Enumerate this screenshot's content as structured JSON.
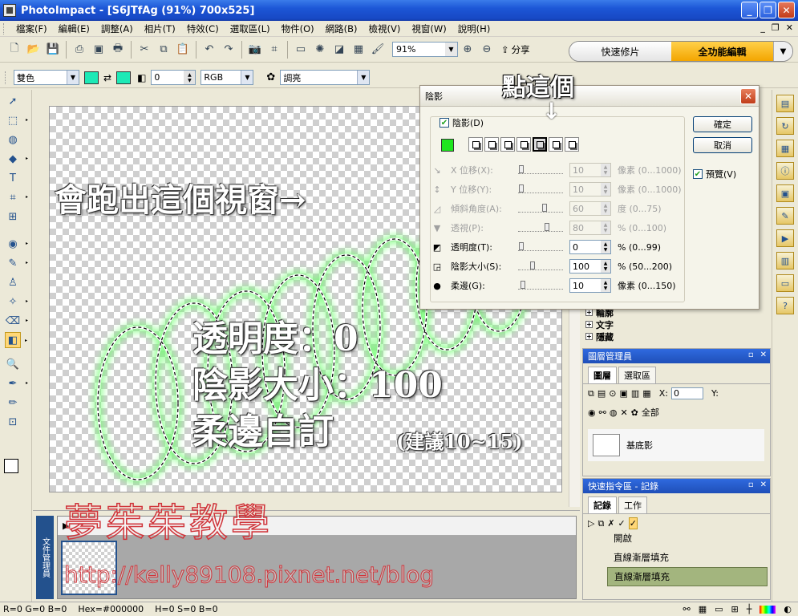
{
  "window": {
    "title": "PhotoImpact - [S6JTfAg (91%) 700x525]"
  },
  "menu": [
    "檔案(F)",
    "編輯(E)",
    "調整(A)",
    "相片(T)",
    "特效(C)",
    "選取區(L)",
    "物件(O)",
    "網路(B)",
    "檢視(V)",
    "視窗(W)",
    "說明(H)"
  ],
  "toolbar": {
    "zoom_value": "91%",
    "share_label": "分享",
    "icons": [
      "new-icon",
      "open-icon",
      "save-icon",
      "scan-icon",
      "capture-icon",
      "print-icon",
      "cut-icon",
      "copy-icon",
      "paste-icon",
      "undo-icon",
      "redo-icon",
      "camera-icon",
      "crop-icon",
      "frame-icon",
      "enhance-icon",
      "chart-icon",
      "filter-icon",
      "paint-icon"
    ]
  },
  "modes": {
    "quick": "快速修片",
    "full": "全功能編輯"
  },
  "attrbar": {
    "mode_value": "雙色",
    "number_value": "0",
    "color_space": "RGB",
    "preset": "調亮",
    "color_fg": "#1de9b6",
    "color_bg": "#1de9b6"
  },
  "tools": [
    "pick-tool",
    "selection-tool",
    "lasso-tool",
    "bezier-tool",
    "text-tool",
    "crop-tool",
    "transform-tool",
    "retouch-tool",
    "paint-tool",
    "clone-tool",
    "magic-tool",
    "eraser-tool",
    "fill-tool",
    "zoom-tool",
    "eyedropper-tool",
    "brush-tool",
    "path-tool"
  ],
  "canvas": {
    "annotation_window": "會跑出這個視窗→",
    "annotation_lines": [
      "透明度：0",
      "陰影大小：100",
      "柔邊自訂"
    ],
    "annotation_suggest": "(建議10~15)",
    "callout": "點這個",
    "callout_arrow": "↓"
  },
  "watermark": {
    "name": "夢茱茱教學",
    "url": "http://kelly89108.pixnet.net/blog"
  },
  "doc_manager": {
    "label": "文件管理員"
  },
  "dialog": {
    "title": "陰影",
    "shadow_check_label": "陰影(D)",
    "shadow_color": "#1ee61e",
    "rows": [
      {
        "label": "X 位移(X):",
        "value": "10",
        "unit": "像素 (0...1000)",
        "enabled": false,
        "icon": "x-offset-icon",
        "glyph": "↘"
      },
      {
        "label": "Y 位移(Y):",
        "value": "10",
        "unit": "像素 (0...1000)",
        "enabled": false,
        "icon": "y-offset-icon",
        "glyph": "↕"
      },
      {
        "label": "傾斜角度(A):",
        "value": "60",
        "unit": "度 (0...75)",
        "enabled": false,
        "icon": "angle-icon",
        "glyph": "◿"
      },
      {
        "label": "透視(P):",
        "value": "80",
        "unit": "% (0...100)",
        "enabled": false,
        "icon": "perspective-icon",
        "glyph": "▼"
      },
      {
        "label": "透明度(T):",
        "value": "0",
        "unit": "% (0...99)",
        "enabled": true,
        "icon": "transparency-icon",
        "glyph": "◩"
      },
      {
        "label": "陰影大小(S):",
        "value": "100",
        "unit": "% (50...200)",
        "enabled": true,
        "icon": "size-icon",
        "glyph": "◲"
      },
      {
        "label": "柔邊(G):",
        "value": "10",
        "unit": "像素 (0...150)",
        "enabled": true,
        "icon": "soft-edge-icon",
        "glyph": "●"
      }
    ],
    "ok_label": "確定",
    "cancel_label": "取消",
    "preview_label": "預覽(V)"
  },
  "layer_panel": {
    "title": "圖層管理員",
    "tabs": [
      "圖層",
      "選取區"
    ],
    "x_label": "X:",
    "x_value": "0",
    "y_label": "Y:",
    "filter_label": "全部",
    "base_layer": "基底影"
  },
  "upper_panel": {
    "tree": [
      "輪廓",
      "文字",
      "隱藏"
    ]
  },
  "quick_panel": {
    "title": "快速指令區 - 記錄",
    "tabs": [
      "記錄",
      "工作"
    ],
    "items": [
      "開啟",
      "直線漸層填充",
      "直線漸層填充"
    ]
  },
  "status": {
    "rgb": "R=0 G=0 B=0",
    "hex": "Hex=#000000",
    "hsb": "H=0 S=0 B=0"
  }
}
